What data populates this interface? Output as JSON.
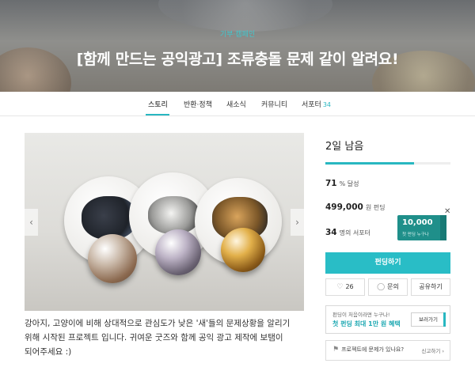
{
  "hero": {
    "category": "기부·캠페인",
    "title": "[함께 만드는 공익광고] 조류충돌 문제 같이 알려요!"
  },
  "tabs": [
    {
      "label": "스토리",
      "active": true
    },
    {
      "label": "반환·정책"
    },
    {
      "label": "새소식"
    },
    {
      "label": "커뮤니티"
    },
    {
      "label": "서포터",
      "count": "34"
    }
  ],
  "gallery": {
    "prev_icon": "chevron-left-icon",
    "next_icon": "chevron-right-icon"
  },
  "description": [
    "강아지, 고양이에 비해 상대적으로 관심도가 낮은 '새'들의 문제상황을 알리기",
    "위해 시작된 프로젝트 입니다. 귀여운 굿즈와 함께 공익 광고 제작에 보탬이",
    "되어주세요 :)"
  ],
  "funding": {
    "remaining": "2일 남음",
    "progress_percent": 71,
    "achieved_value": "71",
    "achieved_unit": "% 달성",
    "amount_value": "499,000",
    "amount_unit": "원 펀딩",
    "supporters_value": "34",
    "supporters_unit": "명의 서포터",
    "fund_button": "펀딩하기",
    "like_count": "26",
    "inquiry_label": "문의",
    "share_label": "공유하기"
  },
  "coupon": {
    "amount": "10,000",
    "subtext": "첫 펀딩 누구나"
  },
  "promo": {
    "line1": "펀딩이 처음이라면 누구나!",
    "line2": "첫 펀딩 최대 1만 원 혜택",
    "button": "보러가기"
  },
  "report": {
    "question": "프로젝트에 문제가 있나요?",
    "link": "신고하기"
  },
  "colors": {
    "accent": "#28b7c1",
    "button": "#29bdc6",
    "coupon": "#1f8f8a"
  }
}
